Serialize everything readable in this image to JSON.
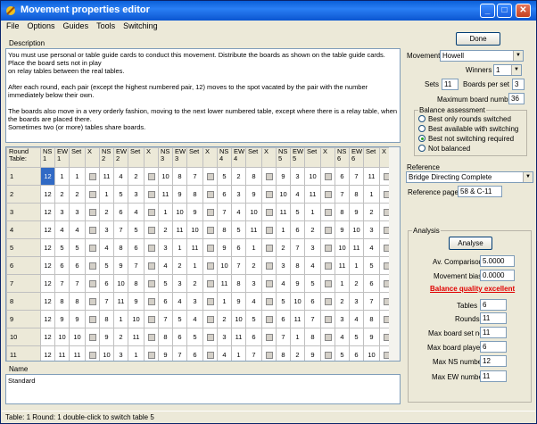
{
  "window": {
    "title": "Movement properties editor"
  },
  "menu": [
    "File",
    "Options",
    "Guides",
    "Tools",
    "Switching"
  ],
  "description": {
    "label": "Description",
    "text": "You must use personal or table guide cards to conduct this movement. Distribute the boards as shown on the table guide cards. Place the board sets not in play\non relay tables between the real tables.\n\nAfter each round, each pair (except the highest numbered pair, 12) moves to the spot vacated by the pair with the number immediately below their own.\n\nThe boards also move in a very orderly fashion, moving to the next lower numbered table, except where there is a relay table, when the boards are placed there.\nSometimes two (or more) tables share boards."
  },
  "done_label": "Done",
  "movement": {
    "label": "Movement",
    "value": "Howell"
  },
  "winners": {
    "label": "Winners",
    "value": "1"
  },
  "sets": {
    "label": "Sets",
    "value": "11"
  },
  "boards_per_set": {
    "label": "Boards per set",
    "value": "3"
  },
  "max_board": {
    "label": "Maximum board number",
    "value": "36"
  },
  "balance": {
    "label": "Balance assessment",
    "options": [
      "Best only rounds switched",
      "Best available with switching",
      "Best not switching required",
      "Not balanced"
    ],
    "selected": 2
  },
  "reference": {
    "label": "Reference",
    "value": "Bridge Directing Complete",
    "page_label": "Reference page:",
    "page_value": "58 & C-11"
  },
  "analysis": {
    "label": "Analysis",
    "analyse": "Analyse",
    "av_label": "Av. Comparison",
    "av_value": "5.0000",
    "bias_label": "Movement bias",
    "bias_value": "0.0000",
    "quality": "Balance quality excellent",
    "tables_label": "Tables",
    "tables": "6",
    "rounds_label": "Rounds",
    "rounds": "11",
    "maxset_label": "Max board set no.",
    "maxset": "11",
    "maxplayed_label": "Max board played",
    "maxplayed": "6",
    "maxns_label": "Max NS number",
    "maxns": "12",
    "maxew_label": "Max EW number",
    "maxew": "11"
  },
  "grid": {
    "headers": [
      "Round\nTable:",
      "NS\n1",
      "EW\n1",
      "Set",
      "X",
      "NS\n2",
      "EW\n2",
      "Set",
      "X",
      "NS\n3",
      "EW\n3",
      "Set",
      "X",
      "NS\n4",
      "EW\n4",
      "Set",
      "X",
      "NS\n5",
      "EW\n5",
      "Set",
      "X",
      "NS\n6",
      "EW\n6",
      "Set",
      "X"
    ],
    "rows": [
      [
        "1",
        [
          "12",
          "1",
          "1"
        ],
        [
          "11",
          "4",
          "2"
        ],
        [
          "10",
          "8",
          "7"
        ],
        [
          "5",
          "2",
          "8"
        ],
        [
          "9",
          "3",
          "10"
        ],
        [
          "6",
          "7",
          "11"
        ]
      ],
      [
        "2",
        [
          "12",
          "2",
          "2"
        ],
        [
          "1",
          "5",
          "3"
        ],
        [
          "11",
          "9",
          "8"
        ],
        [
          "6",
          "3",
          "9"
        ],
        [
          "10",
          "4",
          "11"
        ],
        [
          "7",
          "8",
          "1"
        ]
      ],
      [
        "3",
        [
          "12",
          "3",
          "3"
        ],
        [
          "2",
          "6",
          "4"
        ],
        [
          "1",
          "10",
          "9"
        ],
        [
          "7",
          "4",
          "10"
        ],
        [
          "11",
          "5",
          "1"
        ],
        [
          "8",
          "9",
          "2"
        ]
      ],
      [
        "4",
        [
          "12",
          "4",
          "4"
        ],
        [
          "3",
          "7",
          "5"
        ],
        [
          "2",
          "11",
          "10"
        ],
        [
          "8",
          "5",
          "11"
        ],
        [
          "1",
          "6",
          "2"
        ],
        [
          "9",
          "10",
          "3"
        ]
      ],
      [
        "5",
        [
          "12",
          "5",
          "5"
        ],
        [
          "4",
          "8",
          "6"
        ],
        [
          "3",
          "1",
          "11"
        ],
        [
          "9",
          "6",
          "1"
        ],
        [
          "2",
          "7",
          "3"
        ],
        [
          "10",
          "11",
          "4"
        ]
      ],
      [
        "6",
        [
          "12",
          "6",
          "6"
        ],
        [
          "5",
          "9",
          "7"
        ],
        [
          "4",
          "2",
          "1"
        ],
        [
          "10",
          "7",
          "2"
        ],
        [
          "3",
          "8",
          "4"
        ],
        [
          "11",
          "1",
          "5"
        ]
      ],
      [
        "7",
        [
          "12",
          "7",
          "7"
        ],
        [
          "6",
          "10",
          "8"
        ],
        [
          "5",
          "3",
          "2"
        ],
        [
          "11",
          "8",
          "3"
        ],
        [
          "4",
          "9",
          "5"
        ],
        [
          "1",
          "2",
          "6"
        ]
      ],
      [
        "8",
        [
          "12",
          "8",
          "8"
        ],
        [
          "7",
          "11",
          "9"
        ],
        [
          "6",
          "4",
          "3"
        ],
        [
          "1",
          "9",
          "4"
        ],
        [
          "5",
          "10",
          "6"
        ],
        [
          "2",
          "3",
          "7"
        ]
      ],
      [
        "9",
        [
          "12",
          "9",
          "9"
        ],
        [
          "8",
          "1",
          "10"
        ],
        [
          "7",
          "5",
          "4"
        ],
        [
          "2",
          "10",
          "5"
        ],
        [
          "6",
          "11",
          "7"
        ],
        [
          "3",
          "4",
          "8"
        ]
      ],
      [
        "10",
        [
          "12",
          "10",
          "10"
        ],
        [
          "9",
          "2",
          "11"
        ],
        [
          "8",
          "6",
          "5"
        ],
        [
          "3",
          "11",
          "6"
        ],
        [
          "7",
          "1",
          "8"
        ],
        [
          "4",
          "5",
          "9"
        ]
      ],
      [
        "11",
        [
          "12",
          "11",
          "11"
        ],
        [
          "10",
          "3",
          "1"
        ],
        [
          "9",
          "7",
          "6"
        ],
        [
          "4",
          "1",
          "7"
        ],
        [
          "8",
          "2",
          "9"
        ],
        [
          "5",
          "6",
          "10"
        ]
      ]
    ]
  },
  "name": {
    "label": "Name",
    "value": "Standard"
  },
  "status": "Table: 1 Round: 1 double-click to switch table 5"
}
